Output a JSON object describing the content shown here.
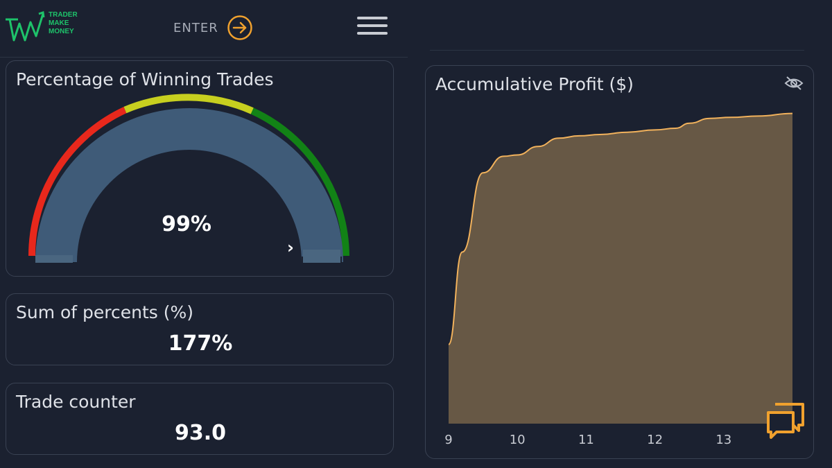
{
  "header": {
    "logo_text": "TRADER\nMAKE\nMONEY",
    "enter_label": "ENTER"
  },
  "gauge": {
    "title": "Percentage of Winning Trades",
    "value_label": "99%",
    "value": 0.99,
    "colors": {
      "red": "#e8281c",
      "yellow": "#c7cf1f",
      "green": "#128216",
      "fill": "#3f5b78"
    }
  },
  "stats": {
    "sum_title": "Sum of percents (%)",
    "sum_value": "177%",
    "counter_title": "Trade counter",
    "counter_value": "93.0"
  },
  "chart_data": {
    "type": "area",
    "title": "Accumulative Profit ($)",
    "xlabel": "",
    "ylabel": "",
    "x_ticks": [
      "9",
      "10",
      "11",
      "12",
      "13"
    ],
    "xlim": [
      9,
      14
    ],
    "ylim": [
      0,
      100
    ],
    "x": [
      9,
      9.2,
      9.5,
      9.8,
      10.0,
      10.3,
      10.6,
      10.9,
      11.2,
      11.6,
      12.0,
      12.3,
      12.5,
      12.8,
      13.1,
      13.5,
      14.0
    ],
    "y": [
      24,
      52,
      76,
      81,
      81.4,
      84,
      86.5,
      87.2,
      87.6,
      88.3,
      89,
      89.5,
      91,
      92.5,
      92.8,
      93.2,
      94
    ],
    "fill_color": "#675845",
    "line_color": "#f2b25c",
    "legend": "none",
    "grid": false
  },
  "icons": {
    "enter": "arrow-right-circle-icon",
    "menu": "hamburger-menu-icon",
    "hide": "eye-off-icon",
    "chat": "chat-bubbles-icon",
    "accent": "#f0a12e"
  }
}
